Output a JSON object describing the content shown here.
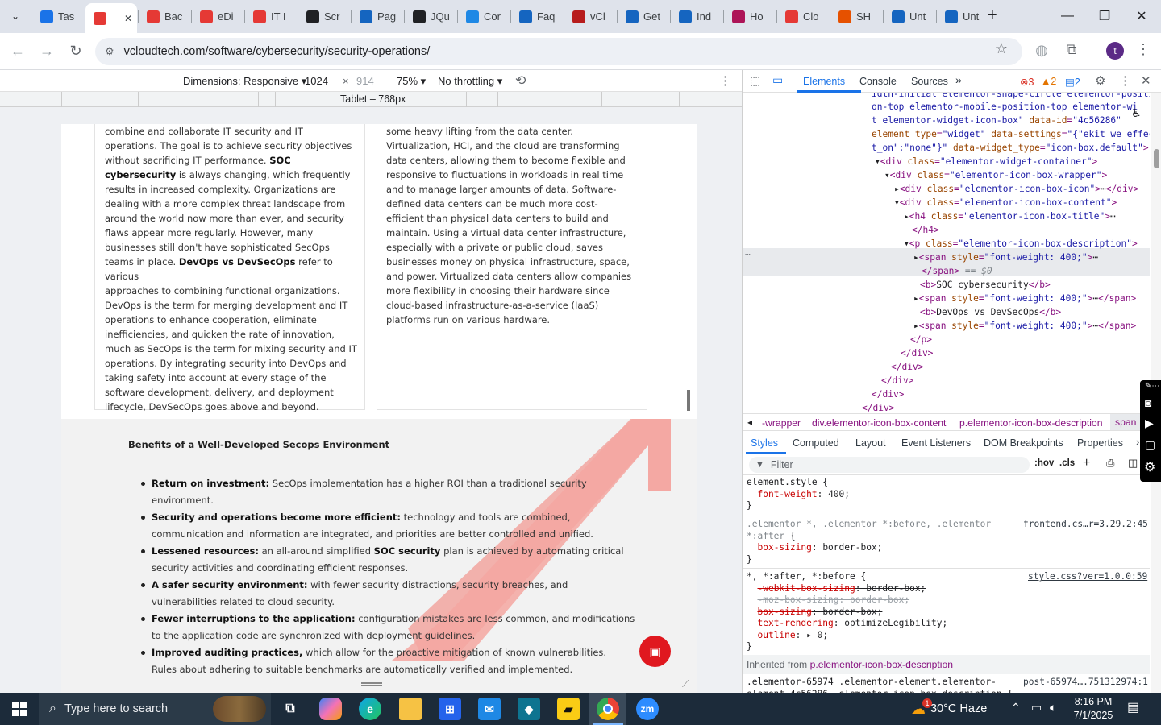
{
  "browser": {
    "tabs": [
      {
        "label": "Tas",
        "color": "#1a73e8"
      },
      {
        "label": "",
        "color": "#e53935"
      },
      {
        "label": "Bac",
        "color": "#e53935"
      },
      {
        "label": "eDi",
        "color": "#e53935"
      },
      {
        "label": "IT I",
        "color": "#e53935"
      },
      {
        "label": "Scr",
        "color": "#202124"
      },
      {
        "label": "Pag",
        "color": "#1565c0"
      },
      {
        "label": "JQu",
        "color": "#202124"
      },
      {
        "label": "Cor",
        "color": "#1e88e5"
      },
      {
        "label": "Faq",
        "color": "#1565c0"
      },
      {
        "label": "vCl",
        "color": "#b71c1c"
      },
      {
        "label": "Get",
        "color": "#1565c0"
      },
      {
        "label": "Ind",
        "color": "#1565c0"
      },
      {
        "label": "Ho",
        "color": "#ad1457"
      },
      {
        "label": "Clo",
        "color": "#e53935"
      },
      {
        "label": "SH",
        "color": "#e65100"
      },
      {
        "label": "Unt",
        "color": "#1565c0"
      },
      {
        "label": "Unt",
        "color": "#1565c0"
      }
    ],
    "new_tab": "+",
    "url": "vcloudtech.com/software/cybersecurity/security-operations/",
    "profile_initial": "t"
  },
  "devmode": {
    "dimensions_label": "Dimensions: Responsive",
    "width": "1024",
    "times": "×",
    "height_placeholder": "914",
    "zoom": "75%",
    "throttle": "No throttling",
    "ruler_label": "Tablet – 768px"
  },
  "page": {
    "left_card": [
      {
        "t": "combine and collaborate IT security and IT",
        "b": false
      },
      {
        "t": "operations. The goal is to achieve security objectives",
        "b": false
      },
      {
        "t": "without sacrificing IT performance. ",
        "b": false,
        "tb": "SOC"
      },
      {
        "t": "",
        "b": true,
        "tb": "cybersecurity",
        "tr": " is always changing, which frequently"
      },
      {
        "t": "results in increased complexity. Organizations are",
        "b": false
      },
      {
        "t": "dealing with a more complex threat landscape from",
        "b": false
      },
      {
        "t": "around the world now more than ever, and security",
        "b": false
      },
      {
        "t": "flaws appear more regularly. However, many",
        "b": false
      },
      {
        "t": "businesses still don't have sophisticated SecOps",
        "b": false
      },
      {
        "t": "teams in place. ",
        "b": false,
        "tb": "DevOps vs DevSecOps",
        "tr": " refer to various"
      },
      {
        "t": "approaches to combining functional organizations.",
        "b": false
      },
      {
        "t": "DevOps is the term for merging development and IT",
        "b": false
      },
      {
        "t": "operations to enhance cooperation, eliminate",
        "b": false
      },
      {
        "t": "inefficiencies, and quicken the rate of innovation,",
        "b": false
      },
      {
        "t": "much as SecOps is the term for mixing security and IT",
        "b": false
      },
      {
        "t": "operations. By integrating security into DevOps and",
        "b": false
      },
      {
        "t": "taking safety into account at every stage of the",
        "b": false
      },
      {
        "t": "software development, delivery, and deployment",
        "b": false
      },
      {
        "t": "lifecycle, DevSecOps goes above and beyond.",
        "b": false
      }
    ],
    "right_card": [
      "some heavy lifting from the data center.",
      "Virtualization, HCI, and the cloud are transforming",
      "data centers, allowing them to become flexible and",
      "responsive to fluctuations in workloads in real time",
      "and to manage larger amounts of data. Software-",
      "defined data centers can be much more cost-",
      "efficient than physical data centers to build and",
      "maintain. Using a virtual data center infrastructure,",
      "especially with a private or public cloud, saves",
      "businesses money on physical infrastructure, space,",
      "and power. Virtualized data centers allow companies",
      "more flexibility in choosing their hardware since",
      "cloud-based infrastructure-as-a-service (IaaS)",
      "platforms run on various hardware."
    ],
    "benefits_title": "Benefits of a Well-Developed Secops Environment",
    "benefits": [
      {
        "bold": "Return on investment:",
        "text": " SecOps implementation has a higher ROI than a traditional security",
        "line2": "environment."
      },
      {
        "bold": "Security and operations become more efficient:",
        "text": " technology and tools are combined,",
        "line2": "communication and information are integrated, and priorities are better controlled and unified."
      },
      {
        "bold": "Lessened resources:",
        "text": " an all-around simplified ",
        "bold2": "SOC security",
        "text2": " plan is achieved by automating critical",
        "line2": "security activities and coordinating efficient responses."
      },
      {
        "bold": "A safer security environment:",
        "text": " with fewer security distractions, security breaches, and",
        "line2": "vulnerabilities related to cloud security."
      },
      {
        "bold": "Fewer interruptions to the application:",
        "text": " configuration mistakes are less common, and modifications",
        "line2": "to the application code are synchronized with deployment guidelines."
      },
      {
        "bold": "Improved auditing practices,",
        "text": " which allow for the proactive mitigation of known vulnerabilities.",
        "line2": "Rules about adhering to suitable benchmarks are automatically verified and implemented."
      }
    ]
  },
  "devtools": {
    "tabs": [
      "Elements",
      "Console",
      "Sources"
    ],
    "errors": "3",
    "warnings": "2",
    "messages": "2",
    "crumbs": [
      "-wrapper",
      "div.elementor-icon-box-content",
      "p.elementor-icon-box-description",
      "span"
    ],
    "sub_tabs": [
      "Styles",
      "Computed",
      "Layout",
      "Event Listeners",
      "DOM Breakpoints",
      "Properties"
    ],
    "filter_placeholder": "Filter",
    "hov": ":hov",
    "cls": ".cls",
    "inherited": "Inherited from ",
    "inherited_sel": "p.elementor-icon-box-description",
    "sources": [
      "frontend.cs…r=3.29.2:45",
      "style.css?ver=1.0.0:59",
      "post-65974….751312974:1"
    ]
  },
  "taskbar": {
    "search_placeholder": "Type here to search",
    "weather": "30°C  Haze",
    "time": "8:16 PM",
    "date": "7/1/2025",
    "weather_badge": "1"
  }
}
